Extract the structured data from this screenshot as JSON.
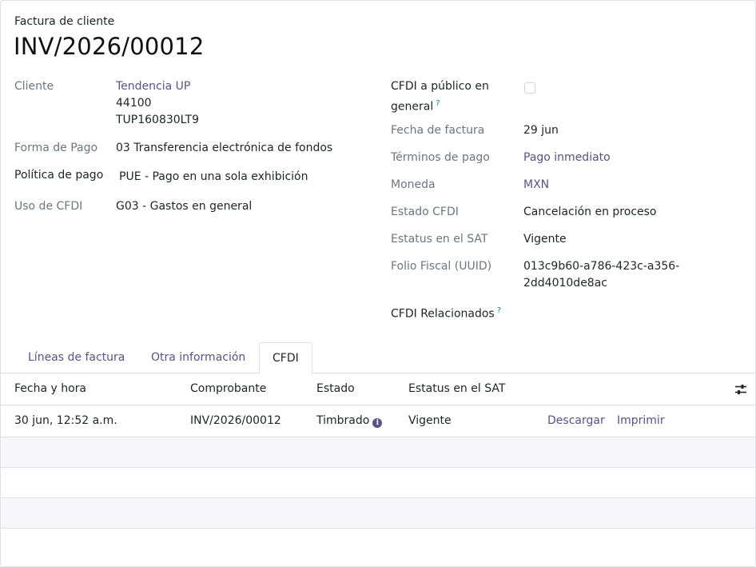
{
  "header": {
    "doc_type": "Factura de cliente",
    "doc_name": "INV/2026/00012"
  },
  "left_fields": {
    "cliente_label": "Cliente",
    "cliente_name": "Tendencia UP",
    "cliente_zip": "44100",
    "cliente_rfc": "TUP160830LT9",
    "forma_pago_label": "Forma de Pago",
    "forma_pago_value": "03 Transferencia electrónica de fondos",
    "politica_label": "Política de pago",
    "politica_value": "PUE - Pago en una sola exhibición",
    "uso_label": "Uso de CFDI",
    "uso_value": "G03 - Gastos en general"
  },
  "right_fields": {
    "publico_label_1": "CFDI a público en",
    "publico_label_2": "general",
    "help_mark": "?",
    "fecha_label": "Fecha de factura",
    "fecha_value": "29 jun",
    "terminos_label": "Términos de pago",
    "terminos_value": "Pago inmediato",
    "moneda_label": "Moneda",
    "moneda_value": "MXN",
    "estado_label": "Estado CFDI",
    "estado_value": "Cancelación en proceso",
    "estatus_label": "Estatus en el SAT",
    "estatus_value": "Vigente",
    "folio_label": "Folio Fiscal (UUID)",
    "folio_value_1": "013c9b60-a786-423c-a356-",
    "folio_value_2": "2dd4010de8ac",
    "relacionados_label": "CFDI Relacionados"
  },
  "tabs": [
    {
      "label": "Líneas de factura"
    },
    {
      "label": "Otra información"
    },
    {
      "label": "CFDI"
    }
  ],
  "table": {
    "columns": [
      "Fecha y hora",
      "Comprobante",
      "Estado",
      "Estatus en el SAT"
    ],
    "rows": [
      {
        "fecha": "30 jun, 12:52 a.m.",
        "comprobante": "INV/2026/00012",
        "estado": "Timbrado",
        "estatus": "Vigente",
        "descargar": "Descargar",
        "imprimir": "Imprimir"
      }
    ]
  },
  "icons": {
    "optional_columns": "sliders-icon",
    "info": "info-circle-icon"
  },
  "colors": {
    "link": "#5b5087",
    "help": "#0a8a8a"
  }
}
